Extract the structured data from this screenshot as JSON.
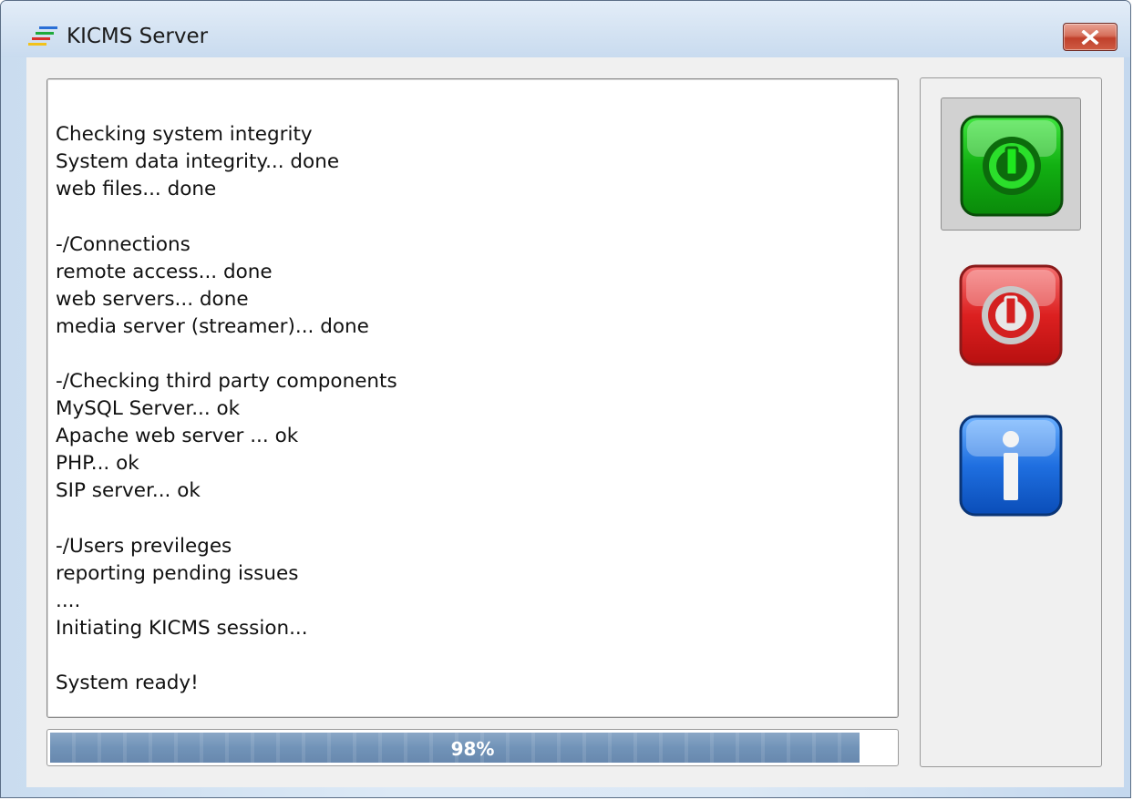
{
  "window": {
    "title": "KICMS Server",
    "close_icon": "close-x-icon"
  },
  "log": {
    "lines": [
      "",
      "Checking system integrity",
      "System data integrity... done",
      "web files... done",
      "",
      "-/Connections",
      "remote access... done",
      "web servers... done",
      "media server (streamer)... done",
      "",
      "-/Checking third party components",
      "MySQL Server... ok",
      "Apache web server ... ok",
      "PHP... ok",
      "SIP server... ok",
      "",
      "-/Users previleges",
      "reporting pending issues",
      "....",
      "Initiating KICMS session...",
      "",
      "System ready!"
    ]
  },
  "progress": {
    "value": 0.98,
    "label": "98%",
    "color": "#7193b8"
  },
  "side_buttons": [
    {
      "icon": "power-on-icon",
      "color": "#1fc21f",
      "selected": true
    },
    {
      "icon": "power-off-icon",
      "color": "#e02020",
      "selected": false
    },
    {
      "icon": "info-icon",
      "color": "#1f6fe0",
      "selected": false
    }
  ]
}
